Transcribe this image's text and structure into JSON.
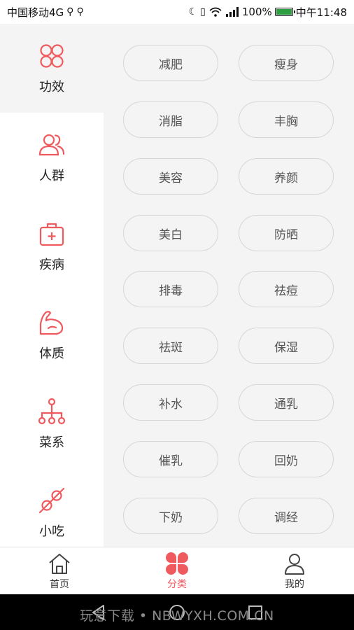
{
  "status_bar": {
    "carrier": "中国移动4G",
    "battery_percent": "100%",
    "time": "中午11:48",
    "battery_color": "#2ea043"
  },
  "sidebar": {
    "items": [
      {
        "label": "功效",
        "icon": "four-circles-icon",
        "active": true
      },
      {
        "label": "人群",
        "icon": "people-icon",
        "active": false
      },
      {
        "label": "疾病",
        "icon": "medical-kit-icon",
        "active": false
      },
      {
        "label": "体质",
        "icon": "muscle-arm-icon",
        "active": false
      },
      {
        "label": "菜系",
        "icon": "hierarchy-icon",
        "active": false
      },
      {
        "label": "小吃",
        "icon": "skewer-icon",
        "active": false
      }
    ]
  },
  "tags": [
    "减肥",
    "瘦身",
    "消脂",
    "丰胸",
    "美容",
    "养颜",
    "美白",
    "防晒",
    "排毒",
    "祛痘",
    "祛斑",
    "保湿",
    "补水",
    "通乳",
    "催乳",
    "回奶",
    "下奶",
    "调经"
  ],
  "tabbar": {
    "items": [
      {
        "label": "首页",
        "icon": "home-icon",
        "active": false
      },
      {
        "label": "分类",
        "icon": "clover-icon",
        "active": true
      },
      {
        "label": "我的",
        "icon": "user-icon",
        "active": false
      }
    ]
  },
  "watermark": "玩意下载 • NBWYXH.COM.CN",
  "colors": {
    "accent": "#ef5a5f",
    "panel_bg": "#f4f4f4",
    "tag_border": "#d6d6d6"
  }
}
